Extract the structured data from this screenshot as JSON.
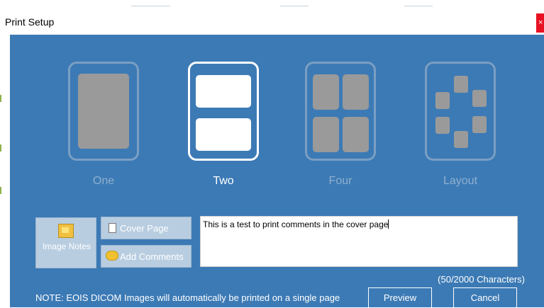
{
  "window": {
    "title": "Print Setup",
    "close_glyph": "×"
  },
  "layout_options": [
    {
      "label": "One",
      "icon": "single-page-icon",
      "selected": false
    },
    {
      "label": "Two",
      "icon": "two-per-page-icon",
      "selected": true
    },
    {
      "label": "Four",
      "icon": "four-per-page-icon",
      "selected": false
    },
    {
      "label": "Layout",
      "icon": "custom-layout-icon",
      "selected": false
    }
  ],
  "buttons": {
    "image_notes": "Image Notes",
    "cover_page": "Cover Page",
    "add_comments": "Add Comments",
    "preview": "Preview",
    "cancel": "Cancel"
  },
  "comments": {
    "text": "This is a test to print comments in the cover page",
    "char_count": "(50/2000 Characters)"
  },
  "note": "NOTE: EOIS DICOM Images will automatically be printed on a single page",
  "colors": {
    "dialog_bg": "#3c7ab5",
    "selected": "#ffffff",
    "unselected": "#9a9a9a"
  }
}
